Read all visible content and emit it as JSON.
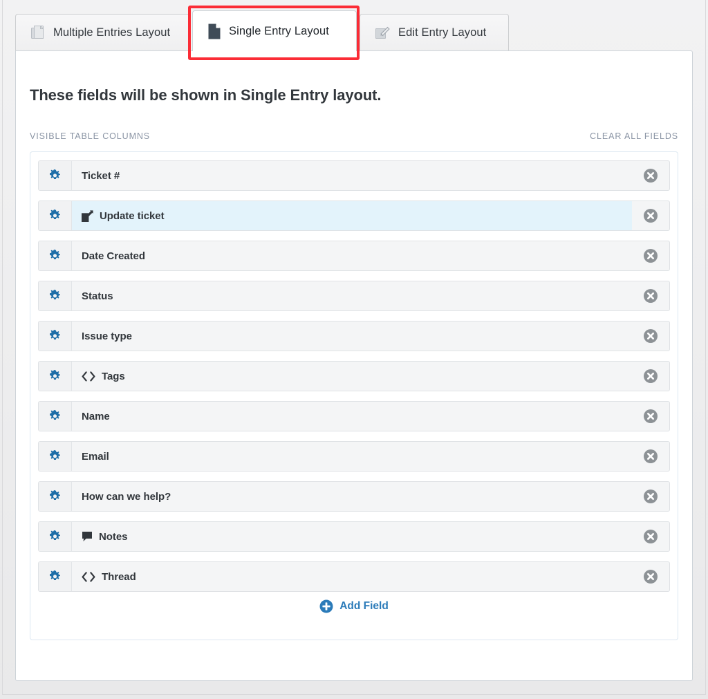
{
  "tabs": [
    {
      "id": "multiple",
      "label": "Multiple Entries Layout",
      "icon": "multiple-documents-icon",
      "active": false
    },
    {
      "id": "single",
      "label": "Single Entry Layout",
      "icon": "single-document-icon",
      "active": true
    },
    {
      "id": "edit",
      "label": "Edit Entry Layout",
      "icon": "pencil-edit-icon",
      "active": false
    }
  ],
  "panel": {
    "heading": "These fields will be shown in Single Entry layout.",
    "columns_label": "VISIBLE TABLE COLUMNS",
    "clear_all_label": "CLEAR ALL FIELDS",
    "add_field_label": "Add Field",
    "add_field_icon": "circle-plus-icon"
  },
  "fields": [
    {
      "label": "Ticket #",
      "icon": null,
      "highlight": false
    },
    {
      "label": "Update ticket",
      "icon": "pencil-edit-icon",
      "highlight": true
    },
    {
      "label": "Date Created",
      "icon": null,
      "highlight": false
    },
    {
      "label": "Status",
      "icon": null,
      "highlight": false
    },
    {
      "label": "Issue type",
      "icon": null,
      "highlight": false
    },
    {
      "label": "Tags",
      "icon": "code-brackets-icon",
      "highlight": false
    },
    {
      "label": "Name",
      "icon": null,
      "highlight": false
    },
    {
      "label": "Email",
      "icon": null,
      "highlight": false
    },
    {
      "label": "How can we help?",
      "icon": null,
      "highlight": false
    },
    {
      "label": "Notes",
      "icon": "comment-icon",
      "highlight": false
    },
    {
      "label": "Thread",
      "icon": "code-brackets-icon",
      "highlight": false
    }
  ],
  "row_controls": {
    "settings_icon": "gear-icon",
    "remove_icon": "remove-circle-icon"
  },
  "colors": {
    "accent_blue": "#2b7bb9",
    "gear_blue": "#1d6ea8",
    "highlight_row": "#e3f3fb",
    "annotation_red": "#fb2c36",
    "heading_text": "#32373c",
    "meta_text": "#8a94a4",
    "remove_gray": "#8a8f94"
  }
}
